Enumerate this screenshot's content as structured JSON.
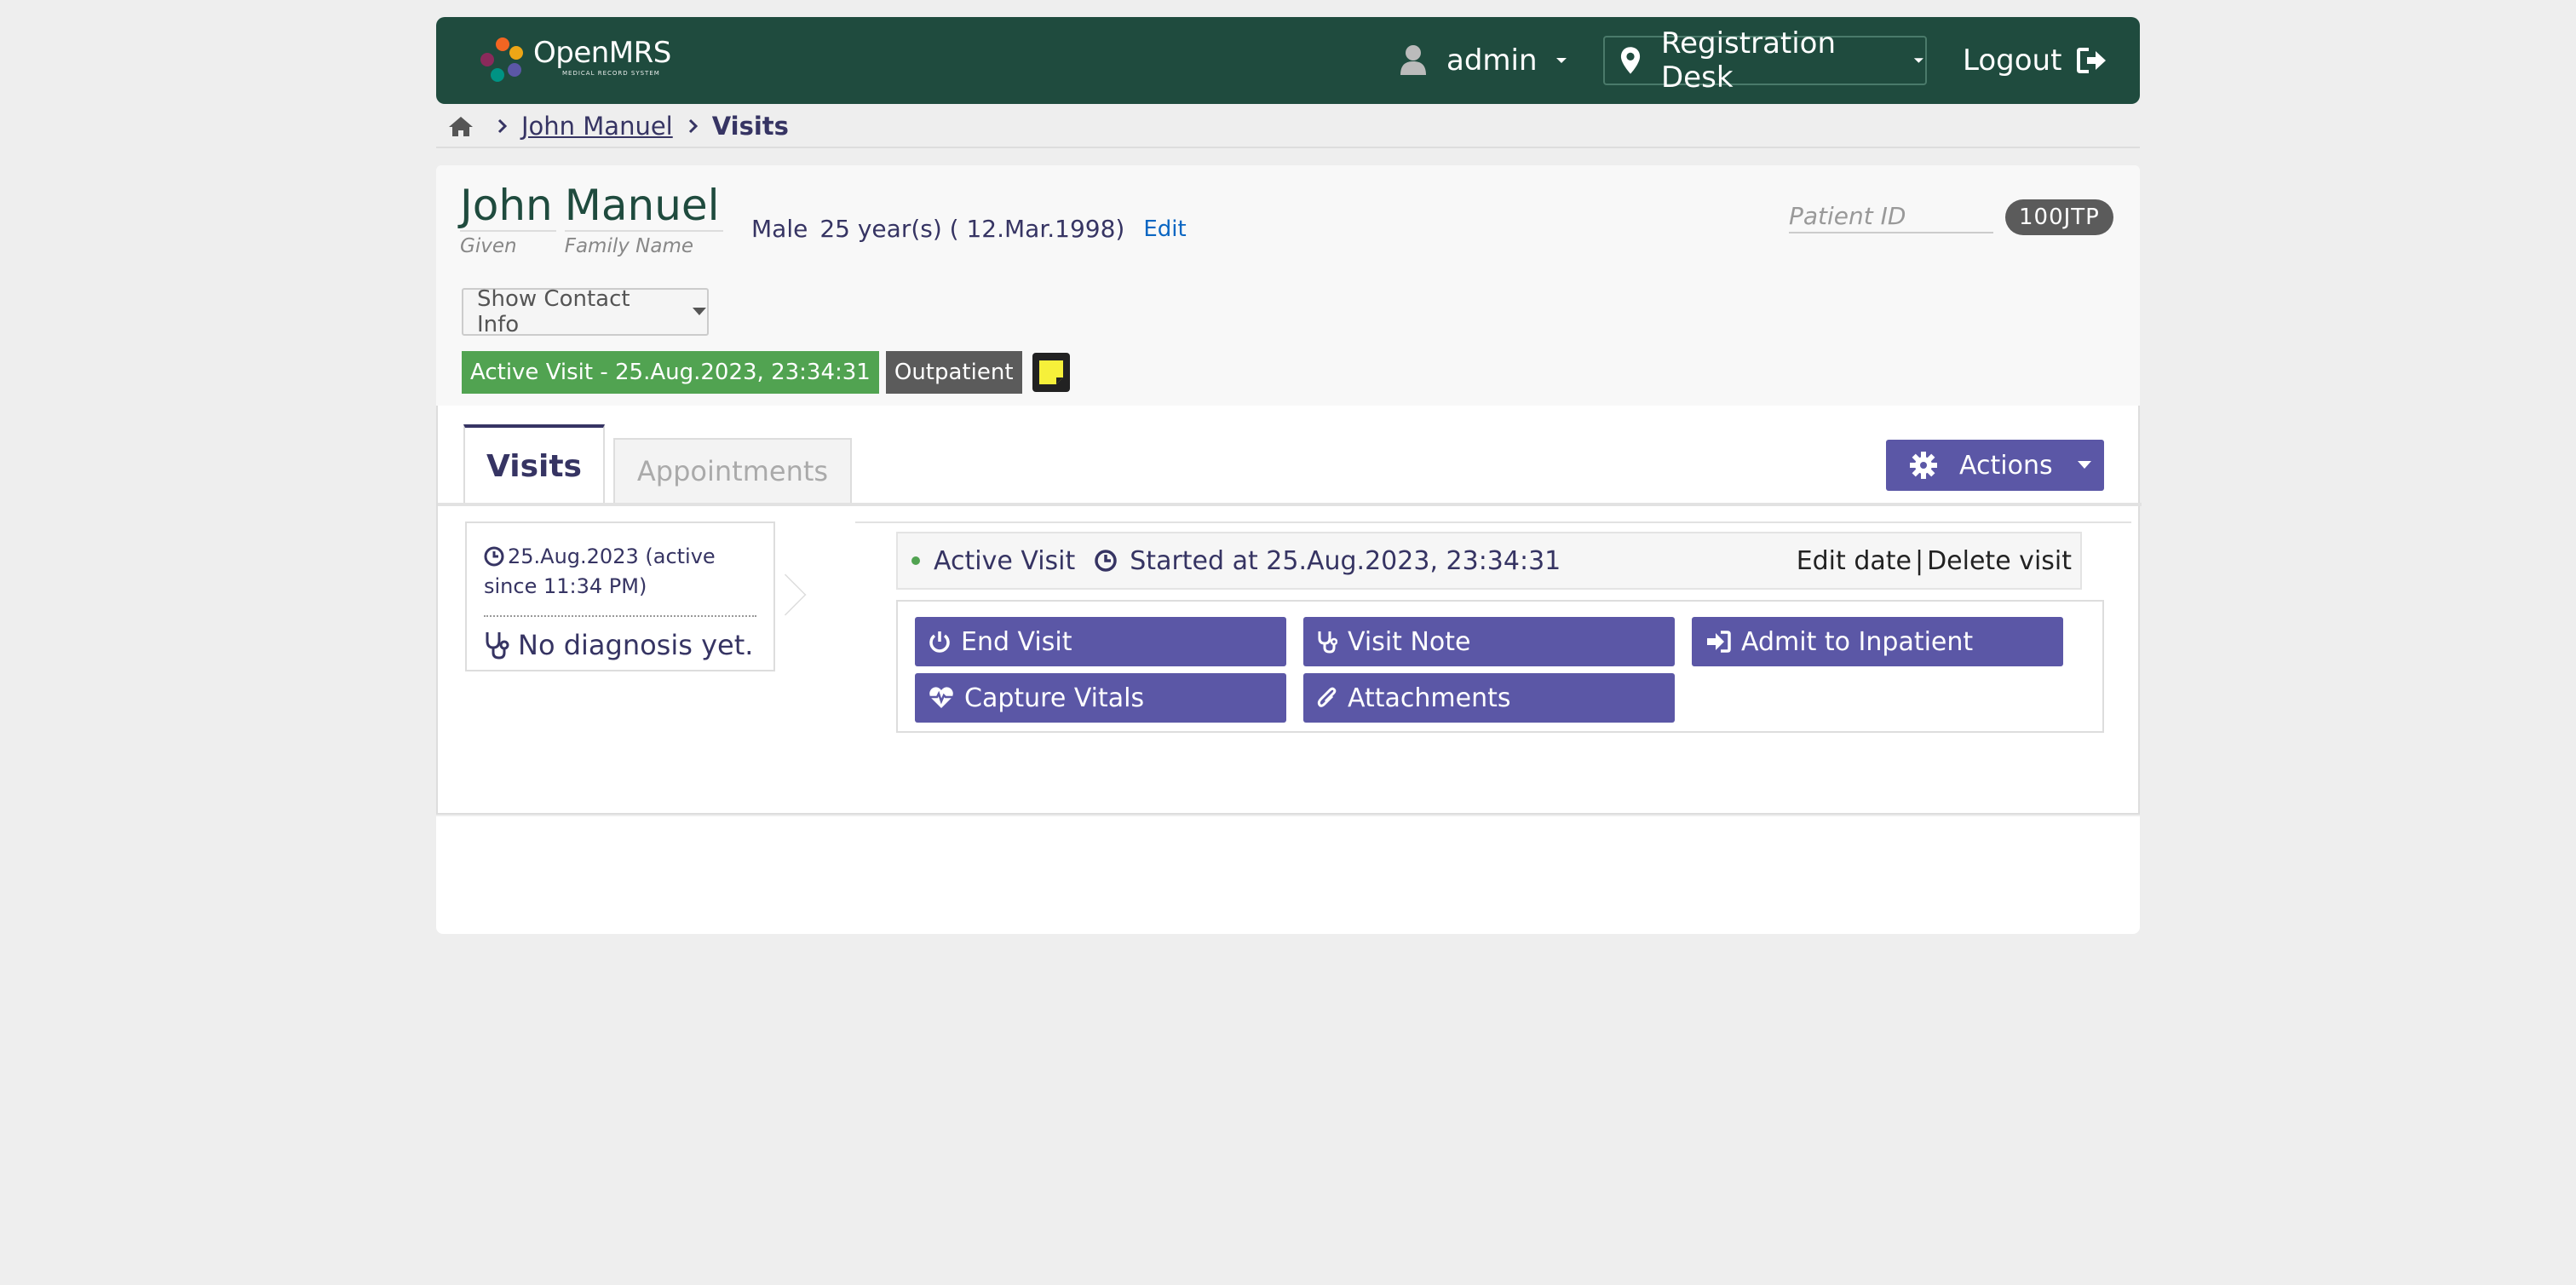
{
  "header": {
    "logo_name": "OpenMRS",
    "logo_tagline": "MEDICAL RECORD SYSTEM",
    "user": "admin",
    "location": "Registration Desk",
    "logout_label": "Logout"
  },
  "breadcrumb": {
    "home_icon": "home-icon",
    "patient": "John Manuel ",
    "current": "Visits"
  },
  "patient": {
    "given_name": "John",
    "family_name": "Manuel",
    "given_label": "Given",
    "family_label": "Family Name",
    "gender": "Male",
    "age": "25 year(s) ( 12.Mar.1998)",
    "edit_label": "Edit",
    "patient_id_label": "Patient ID",
    "patient_id": "100JTP",
    "show_contact_label": "Show Contact Info",
    "active_visit_badge": "Active Visit - 25.Aug.2023, 23:34:31",
    "visit_type_badge": "Outpatient"
  },
  "tabs": {
    "visits": "Visits",
    "appointments": "Appointments"
  },
  "actions_label": "Actions",
  "visit_list": {
    "date": "25.Aug.2023 (active since 11:34 PM)",
    "diagnosis": "No diagnosis yet."
  },
  "visit_detail": {
    "status": "Active Visit",
    "started": "Started at 25.Aug.2023, 23:34:31",
    "edit_date": "Edit date",
    "separator": "|",
    "delete_visit": "Delete visit",
    "buttons": {
      "end_visit": "End Visit",
      "visit_note": "Visit Note",
      "admit": "Admit to Inpatient",
      "capture_vitals": "Capture Vitals",
      "attachments": "Attachments"
    }
  },
  "colors": {
    "header_bg": "#1f4b3e",
    "accent_purple": "#5b57a6",
    "active_green": "#51a351",
    "badge_gray": "#5b5b5b",
    "text_navy": "#363463"
  }
}
